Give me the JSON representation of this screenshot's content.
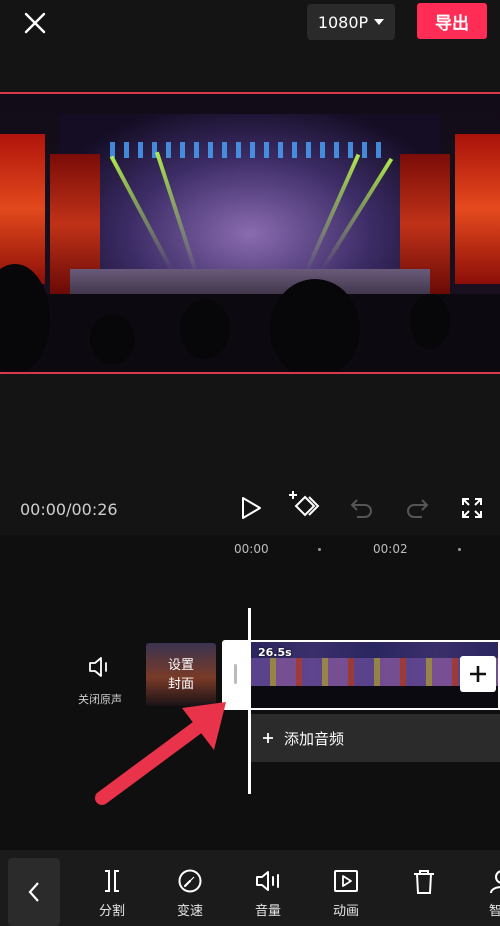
{
  "topbar": {
    "resolution": "1080P",
    "export_label": "导出"
  },
  "playback": {
    "timecode": "00:00/00:26"
  },
  "ruler": {
    "ticks": [
      "00:00",
      "00:02"
    ]
  },
  "track": {
    "mute_label": "关闭原声",
    "cover_label_line1": "设置",
    "cover_label_line2": "封面",
    "clip_duration": "26.5s",
    "add_audio_label": "添加音频"
  },
  "toolbar": {
    "items": [
      {
        "label": "分割",
        "icon": "split-icon"
      },
      {
        "label": "变速",
        "icon": "speed-icon"
      },
      {
        "label": "音量",
        "icon": "volume-icon"
      },
      {
        "label": "动画",
        "icon": "animation-icon"
      },
      {
        "label": "",
        "icon": "delete-icon"
      },
      {
        "label": "智能",
        "icon": "smart-icon"
      }
    ]
  },
  "colors": {
    "accent": "#ff2c55",
    "annotation_arrow": "#e8334a"
  }
}
